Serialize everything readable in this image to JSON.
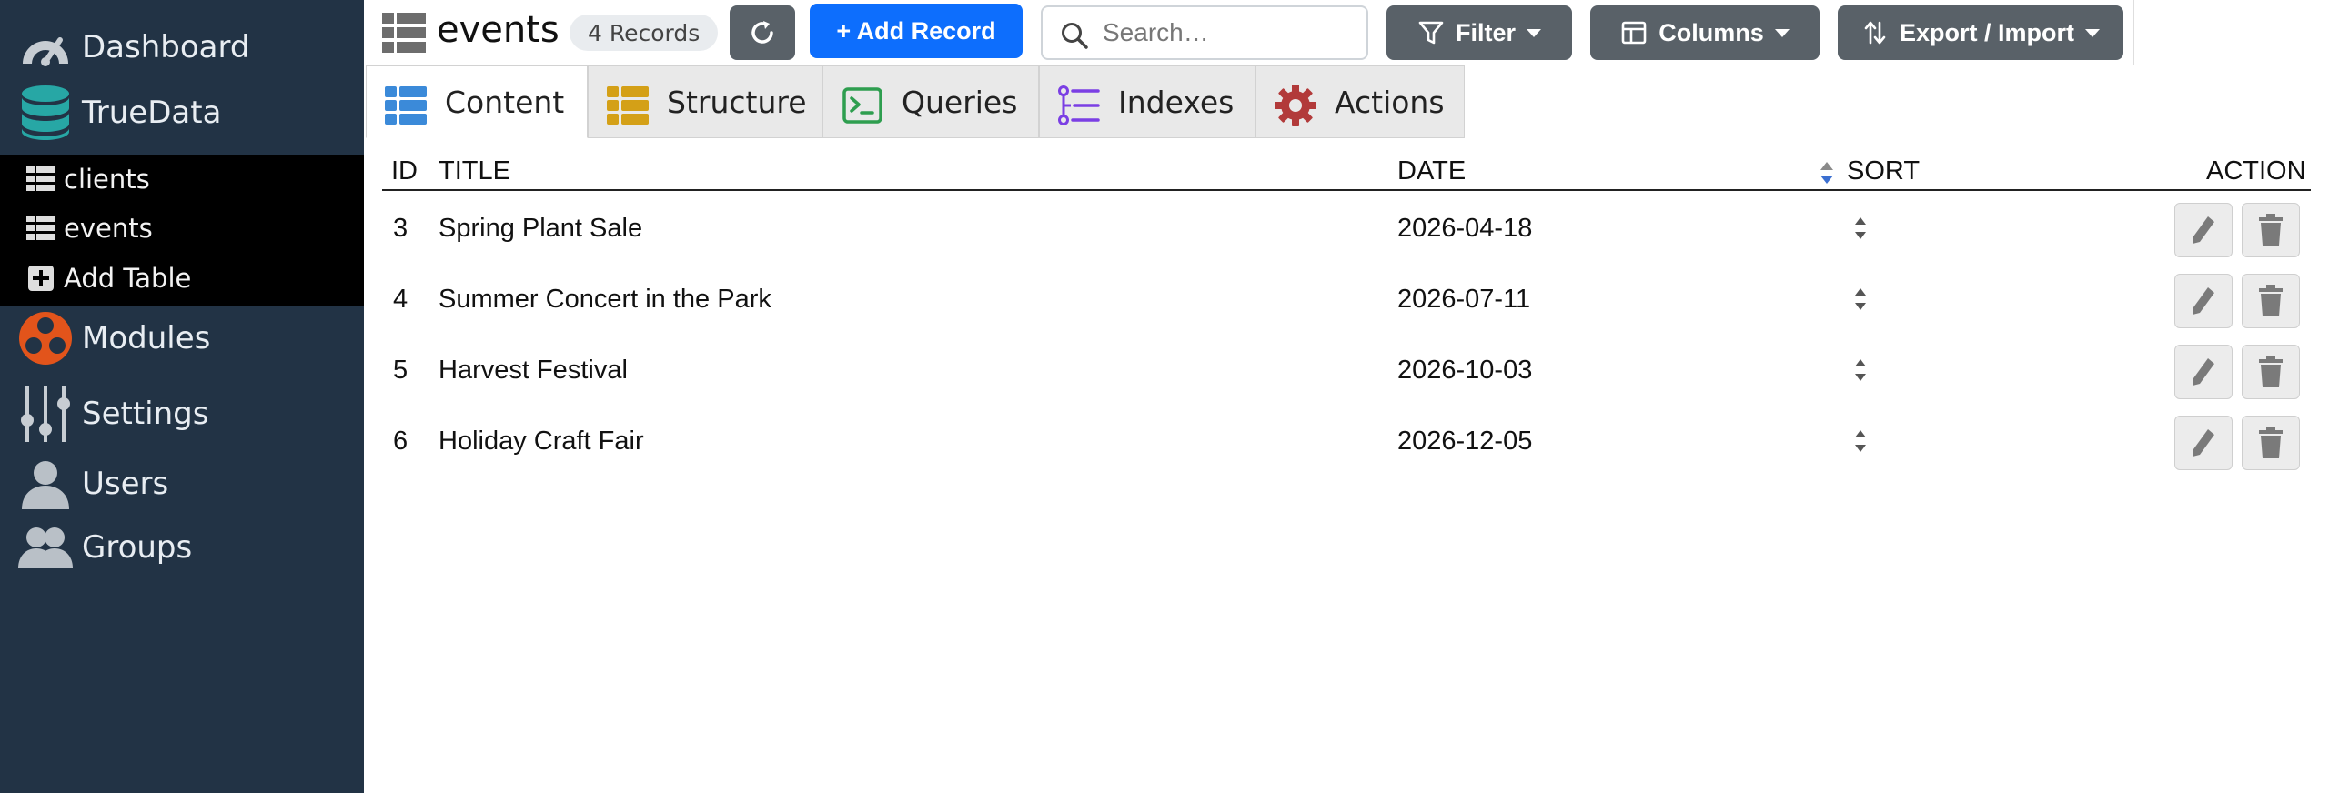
{
  "sidebar": {
    "dashboard": "Dashboard",
    "truedata": "TrueData",
    "tables": [
      {
        "label": "clients"
      },
      {
        "label": "events"
      }
    ],
    "add_table": "Add Table",
    "modules": "Modules",
    "settings": "Settings",
    "users": "Users",
    "groups": "Groups"
  },
  "header": {
    "title": "events",
    "records_badge": "4 Records",
    "add_record_label": "+ Add Record",
    "search_placeholder": "Search…",
    "filter_label": "Filter",
    "columns_label": "Columns",
    "export_label": "Export / Import"
  },
  "tabs": [
    {
      "label": "Content"
    },
    {
      "label": "Structure"
    },
    {
      "label": "Queries"
    },
    {
      "label": "Indexes"
    },
    {
      "label": "Actions"
    }
  ],
  "table": {
    "headers": {
      "id": "ID",
      "title": "TITLE",
      "date": "DATE",
      "sort": "SORT",
      "action": "ACTION"
    },
    "rows": [
      {
        "id": "3",
        "title": "Spring Plant Sale",
        "date": "2026-04-18"
      },
      {
        "id": "4",
        "title": "Summer Concert in the Park",
        "date": "2026-07-11"
      },
      {
        "id": "5",
        "title": "Harvest Festival",
        "date": "2026-10-03"
      },
      {
        "id": "6",
        "title": "Holiday Craft Fair",
        "date": "2026-12-05"
      }
    ]
  },
  "icons": {
    "dashboard": "gauge-icon",
    "truedata": "database-icon",
    "table": "table-icon",
    "add": "plus-square-icon",
    "modules": "modules-icon",
    "settings": "sliders-icon",
    "users": "user-icon",
    "groups": "users-icon",
    "refresh": "refresh-icon",
    "search": "search-icon",
    "filter": "filter-icon",
    "columns": "columns-icon",
    "export": "sort-arrows-icon",
    "edit": "pencil-icon",
    "delete": "trash-icon"
  },
  "colors": {
    "sidebar_bg": "#223345",
    "subnav_bg": "#000000",
    "primary": "#0d6efd",
    "secondary_btn": "#596168",
    "content_tab_icon": "#3b8ad9",
    "structure_tab_icon": "#d4a017",
    "queries_tab_icon": "#2e9e4f",
    "indexes_tab_icon": "#7b3fe4",
    "actions_tab_icon": "#b23a3a",
    "truedata_icon": "#27a7a5",
    "modules_icon": "#e2541b"
  }
}
